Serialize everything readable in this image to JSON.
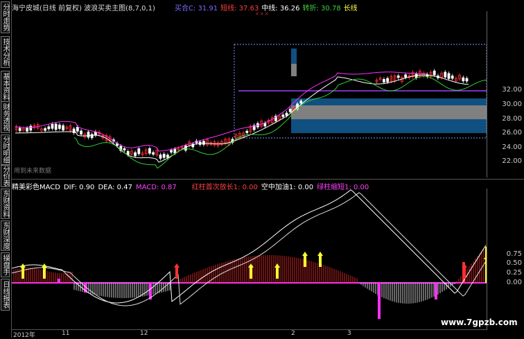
{
  "sidebar": {
    "tabs": [
      "分时走势",
      "技术分析",
      "基本资料",
      "财务透视",
      "分时明细",
      "分价表",
      "东财资料",
      "东财深度",
      "操盘手",
      "日线报表"
    ]
  },
  "header": {
    "title": "海宁皮城(日线 前复权) 波浪买卖主图(8,7,0,1)",
    "indicators": [
      {
        "label": "买合C: 31.91",
        "color": "#7b6cff"
      },
      {
        "label": "短线: 37.63",
        "color": "#ff4040"
      },
      {
        "label": "中线: 36.26",
        "color": "#ffffff"
      },
      {
        "label": "转折: 30.78",
        "color": "#3fd23f"
      },
      {
        "label": "长线",
        "color": "#ffff40"
      }
    ],
    "markers": "×××"
  },
  "main_axis": {
    "ticks": [
      "32.00",
      "30.00",
      "28.00",
      "26.00",
      "24.00",
      "22.00"
    ]
  },
  "note": "用到未来数据",
  "macd_header": {
    "items": [
      {
        "label": "精美彩色MACD",
        "color": "#ffffff"
      },
      {
        "label": "DIF: 0.90",
        "color": "#ffffff"
      },
      {
        "label": "DEA: 0.47",
        "color": "#ffffff"
      },
      {
        "label": "MACD: 0.87",
        "color": "#ff40ff"
      },
      {
        "label": "红柱首次放长1: 0.00",
        "color": "#ff4040"
      },
      {
        "label": "空中加油1: 0.00",
        "color": "#ffffff"
      },
      {
        "label": "绿柱缩短1: 0.00",
        "color": "#ff40ff"
      }
    ]
  },
  "macd_axis": {
    "ticks": [
      "0.75",
      "0.50",
      "0.25",
      "0.00"
    ]
  },
  "dates": [
    "2012年",
    "11",
    "12",
    "2",
    "3"
  ],
  "watermark": "www.7gpzb.com",
  "colors": {
    "up": "#ff3030",
    "down": "#40e0e0",
    "white": "#ffffff",
    "yellow": "#ffff30",
    "magenta": "#ff30ff",
    "green": "#30d030",
    "purple": "#a040ff",
    "blue": "#105080",
    "gray": "#808080"
  }
}
